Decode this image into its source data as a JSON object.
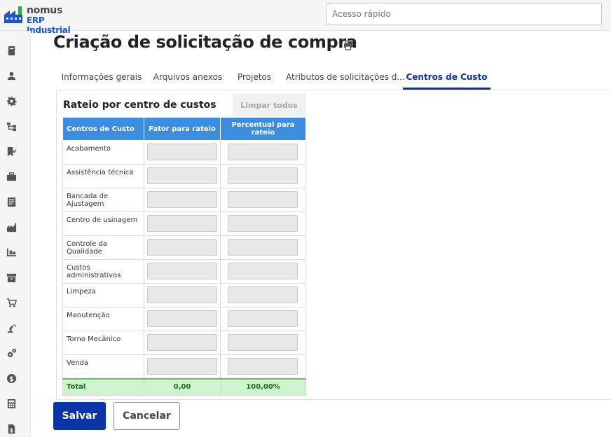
{
  "header": {
    "brand": "nomus",
    "brand_sub": "ERP Industrial",
    "quick_access_placeholder": "Acesso rápido"
  },
  "sidebar": {
    "icons": [
      "book-icon",
      "user-icon",
      "gear-icon",
      "hierarchy-icon",
      "bookmark-check-icon",
      "briefcase-icon",
      "document-icon",
      "factory-icon",
      "pallet-icon",
      "archive-icon",
      "cart-icon",
      "robot-arm-icon",
      "gears-icon",
      "dollar-icon",
      "calculator-icon",
      "invoice-icon"
    ]
  },
  "page": {
    "title": "Criação de solicitação de compra"
  },
  "tabs": [
    {
      "label": "Informações gerais"
    },
    {
      "label": "Arquivos anexos"
    },
    {
      "label": "Projetos"
    },
    {
      "label": "Atributos de solicitações d..."
    },
    {
      "label": "Centros de Custo"
    }
  ],
  "cost_centers": {
    "title": "Rateio por centro de custos",
    "clear_all_label": "Limpar todos",
    "columns": [
      "Centros de Custo",
      "Fator para rateio",
      "Percentual para rateio"
    ],
    "rows": [
      {
        "name": "Acabamento"
      },
      {
        "name": "Assistência técnica"
      },
      {
        "name": "Bancada de Ajustagem"
      },
      {
        "name": "Centro de usinagem"
      },
      {
        "name": "Controle da Qualidade"
      },
      {
        "name": "Custos administrativos"
      },
      {
        "name": "Limpeza"
      },
      {
        "name": "Manutenção"
      },
      {
        "name": "Torno Mecânico"
      },
      {
        "name": "Venda"
      }
    ],
    "total_label": "Total",
    "total_factor": "0,00",
    "total_percent": "100,00%"
  },
  "actions": {
    "save_label": "Salvar",
    "cancel_label": "Cancelar"
  },
  "colors": {
    "primary": "#0a35a8",
    "table_header": "#3c8de0",
    "total_row": "#cff2cf"
  }
}
